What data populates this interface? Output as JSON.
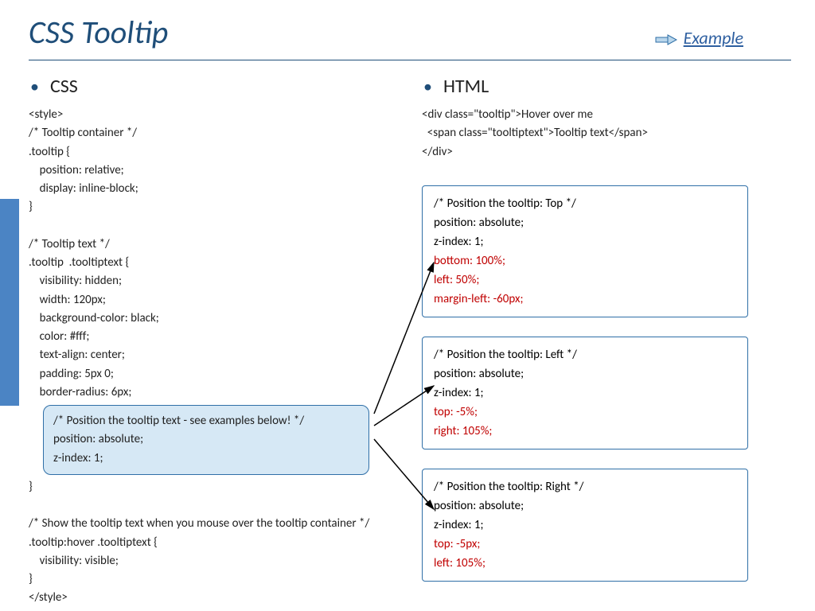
{
  "header": {
    "title": "CSS Tooltip",
    "example_link": "Example"
  },
  "css_col": {
    "heading": "CSS",
    "pre_callout": "<style>\n/* Tooltip container */\n.tooltip {\n    position: relative;\n    display: inline-block;\n}\n\n/* Tooltip text */\n.tooltip  .tooltiptext {\n    visibility: hidden;\n    width: 120px;\n    background-color: black;\n    color: #fff;\n    text-align: center;\n    padding: 5px 0;\n    border-radius: 6px;\n",
    "callout": "/* Position the tooltip text - see examples below! */\nposition: absolute;\nz-index: 1;",
    "post_callout": "}\n\n/* Show the tooltip text when you mouse over the tooltip container */\n.tooltip:hover .tooltiptext {\n    visibility: visible;\n}\n</style>"
  },
  "html_col": {
    "heading": "HTML",
    "snippet": "<div class=\"tooltip\">Hover over me\n  <span class=\"tooltiptext\">Tooltip text</span>\n</div>"
  },
  "variants": {
    "top": {
      "l1": "/* Position the tooltip: Top */",
      "l2": "position: absolute;",
      "l3": "z-index: 1;",
      "r1": "bottom: 100%;",
      "r2": "left: 50%;",
      "r3": "margin-left: -60px;"
    },
    "left": {
      "l1": "/* Position the tooltip: Left */",
      "l2": "position: absolute;",
      "l3": "z-index: 1;",
      "r1": "top: -5%;",
      "r2": "right: 105%;"
    },
    "right": {
      "l1": "/* Position the tooltip: Right */",
      "l2": "position: absolute;",
      "l3": "z-index: 1;",
      "r1": "top: -5px;",
      "r2": "left: 105%;"
    }
  }
}
